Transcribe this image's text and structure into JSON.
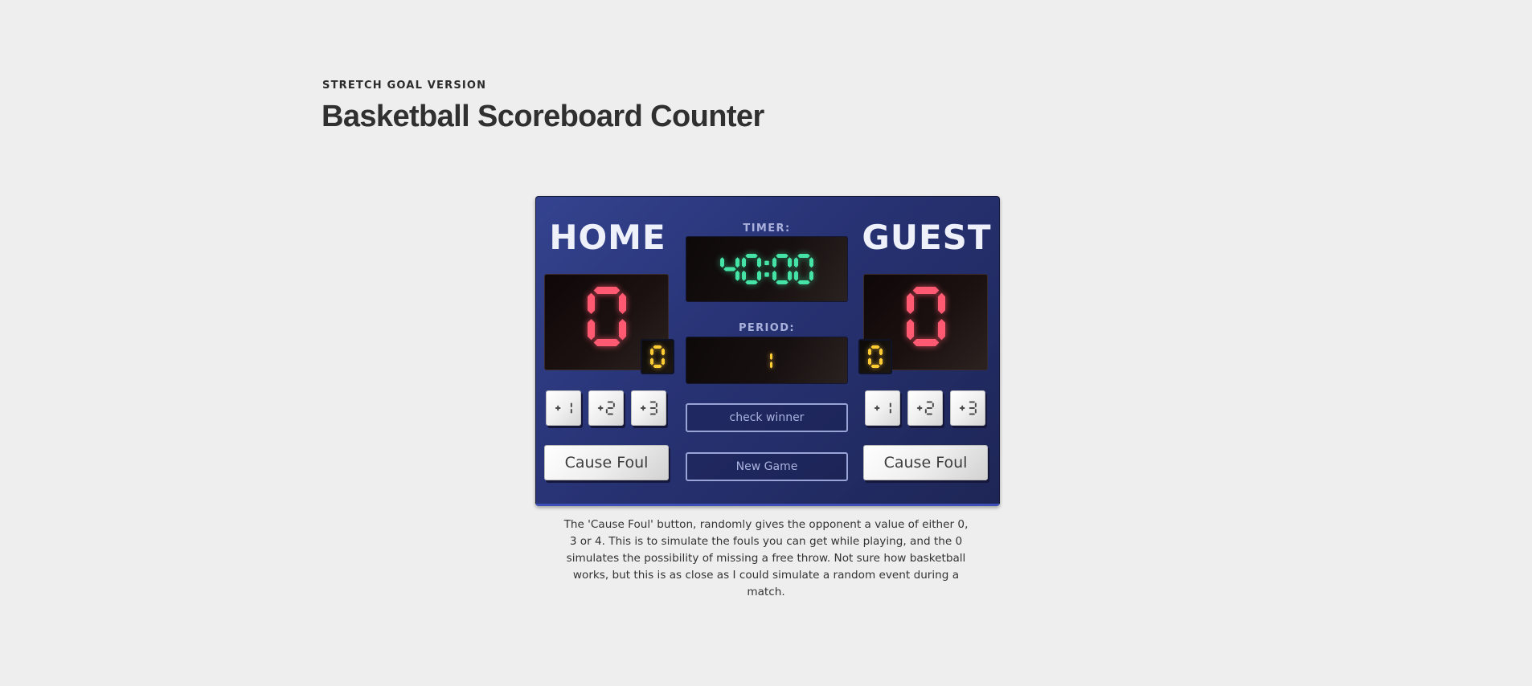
{
  "header": {
    "eyebrow": "STRETCH GOAL VERSION",
    "title": "Basketball Scoreboard Counter"
  },
  "scoreboard": {
    "home": {
      "title": "HOME",
      "score": "0",
      "fouls": "0",
      "point_buttons": [
        "+1",
        "+2",
        "+3"
      ],
      "foul_button_label": "Cause Foul"
    },
    "guest": {
      "title": "GUEST",
      "score": "0",
      "fouls": "0",
      "point_buttons": [
        "+1",
        "+2",
        "+3"
      ],
      "foul_button_label": "Cause Foul"
    },
    "timer": {
      "label": "TIMER:",
      "value": "40:00"
    },
    "period": {
      "label": "PERIOD:",
      "value": "1"
    },
    "check_winner_label": "check winner",
    "new_game_label": "New Game"
  },
  "description": "The 'Cause Foul' button, randomly gives the opponent a value of either 0, 3 or 4. This is to simulate the fouls you can get while playing, and the 0 simulates the possibility of missing a free throw. Not sure how basketball works, but this is as close as I could simulate a random event during a match.",
  "colors": {
    "score_digits": "#ff5a72",
    "timer_digits": "#45e3a6",
    "period_digits": "#ffcc33",
    "foul_digits": "#ffcc33",
    "board_background": "#2a3679",
    "button_digits": "#4a4a4a"
  }
}
